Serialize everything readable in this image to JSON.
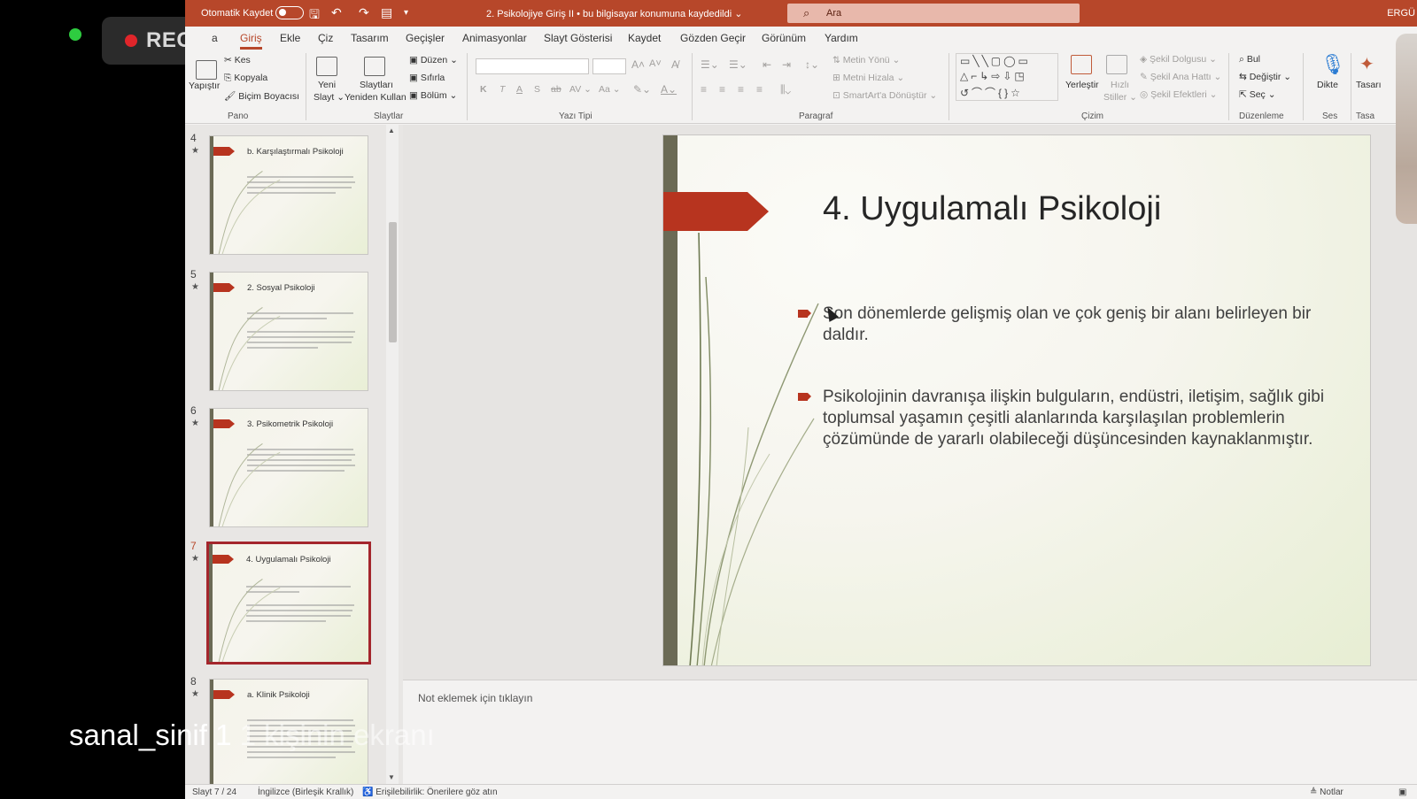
{
  "recording": {
    "label": "REC"
  },
  "titlebar": {
    "autosave_label": "Otomatik Kaydet",
    "doc_title": "2. Psikolojiye Giriş II  •  bu bilgisayar konumuna kaydedildi ⌄",
    "search_placeholder": "Ara",
    "user": "ERGÜ"
  },
  "tabs": [
    "a",
    "Giriş",
    "Ekle",
    "Çiz",
    "Tasarım",
    "Geçişler",
    "Animasyonlar",
    "Slayt Gösterisi",
    "Kaydet",
    "Gözden Geçir",
    "Görünüm",
    "Yardım"
  ],
  "ribbon": {
    "pano": {
      "paste": "Yapıştır",
      "cut": "Kes",
      "copy": "Kopyala",
      "format_painter": "Biçim Boyacısı",
      "group": "Pano"
    },
    "slaytlar": {
      "new_slide_1": "Yeni",
      "new_slide_2": "Slayt ⌄",
      "reuse_1": "Slaytları",
      "reuse_2": "Yeniden Kullan",
      "layout": "Düzen ⌄",
      "reset": "Sıfırla",
      "section": "Bölüm ⌄",
      "group": "Slaytlar"
    },
    "font": {
      "group": "Yazı Tipi",
      "buttons": [
        "K",
        "T",
        "A",
        "S",
        "ab",
        "AV ⌄",
        "Aa ⌄"
      ]
    },
    "paragraph": {
      "text_direction": "Metin Yönü ⌄",
      "align_text": "Metni Hizala ⌄",
      "smartart": "SmartArt'a Dönüştür ⌄",
      "group": "Paragraf"
    },
    "drawing": {
      "arrange": "Yerleştir",
      "quick_styles_1": "Hızlı",
      "quick_styles_2": "Stiller ⌄",
      "fill": "Şekil Dolgusu ⌄",
      "outline": "Şekil Ana Hattı ⌄",
      "effects": "Şekil Efektleri ⌄",
      "group": "Çizim"
    },
    "editing": {
      "find": "Bul",
      "replace": "Değiştir ⌄",
      "select": "Seç ⌄",
      "group": "Düzenleme"
    },
    "voice": {
      "dictate": "Dikte",
      "group": "Ses"
    },
    "designer": {
      "label": "Tasarı",
      "group": "Tasa"
    }
  },
  "thumbnails": [
    {
      "num": "4",
      "title": "b. Karşılaştırmalı Psikoloji"
    },
    {
      "num": "5",
      "title": "2. Sosyal Psikoloji"
    },
    {
      "num": "6",
      "title": "3. Psikometrik Psikoloji"
    },
    {
      "num": "7",
      "title": "4. Uygulamalı Psikoloji"
    },
    {
      "num": "8",
      "title": "a. Klinik Psikoloji"
    }
  ],
  "slide": {
    "title": "4. Uygulamalı Psikoloji",
    "bullets": [
      "Son dönemlerde gelişmiş olan ve çok geniş bir alanı belirleyen bir daldır.",
      "Psikolojinin davranışa ilişkin bulguların, endüstri, iletişim, sağlık gibi toplumsal yaşamın çeşitli alanlarında karşılaşılan problemlerin çözümünde de yararlı olabileceği düşüncesinden kaynaklanmıştır."
    ]
  },
  "notes": {
    "placeholder": "Not eklemek için tıklayın"
  },
  "statusbar": {
    "slide": "Slayt 7 / 24",
    "language": "İngilizce (Birleşik Krallık)",
    "accessibility": "Erişilebilirlik: Önerilere göz atın",
    "notes": "Notlar"
  },
  "overlay": {
    "caption_start": "sanal_sinif 1",
    "caption_end": "kişinin ekranı"
  },
  "colors": {
    "accent": "#b7472a",
    "arrow": "#b7341f"
  }
}
